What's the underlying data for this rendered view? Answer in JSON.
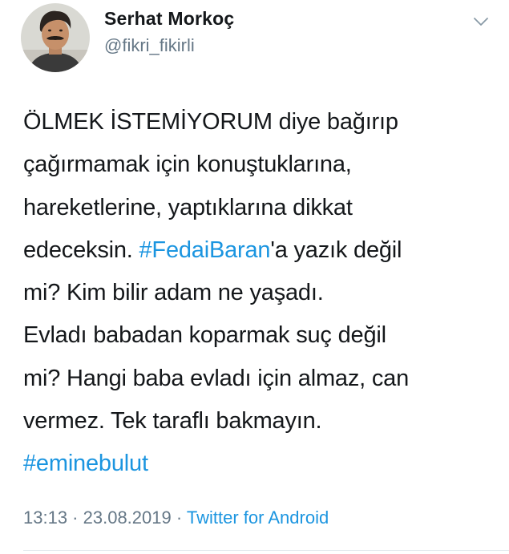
{
  "author": {
    "display_name": "Serhat Morkoç",
    "handle": "@fikri_fikirli"
  },
  "tweet": {
    "lines": [
      [
        {
          "text": "ÖLMEK İSTEMİYORUM diye bağırıp"
        }
      ],
      [
        {
          "text": "çağırmamak için konuştuklarına,"
        }
      ],
      [
        {
          "text": "hareketlerine, yaptıklarına dikkat"
        }
      ],
      [
        {
          "text": "edeceksin. "
        },
        {
          "text": "#FedaiBaran",
          "hashtag": true
        },
        {
          "text": "'a yazık değil"
        }
      ],
      [
        {
          "text": "mi? Kim bilir adam ne yaşadı."
        }
      ],
      [
        {
          "text": "Evladı babadan koparmak suç değil"
        }
      ],
      [
        {
          "text": "mi? Hangi baba evladı için almaz, can"
        }
      ],
      [
        {
          "text": "vermez. Tek taraflı bakmayın."
        }
      ],
      [
        {
          "text": "#eminebulut",
          "hashtag": true
        }
      ]
    ]
  },
  "meta": {
    "time": "13:13",
    "separator1": " · ",
    "date": "23.08.2019",
    "separator2": " · ",
    "source": "Twitter for Android"
  },
  "colors": {
    "link": "#1b95e0",
    "secondary_text": "#657786",
    "primary_text": "#14171a"
  },
  "icons": {
    "chevron": "chevron-down-icon"
  }
}
